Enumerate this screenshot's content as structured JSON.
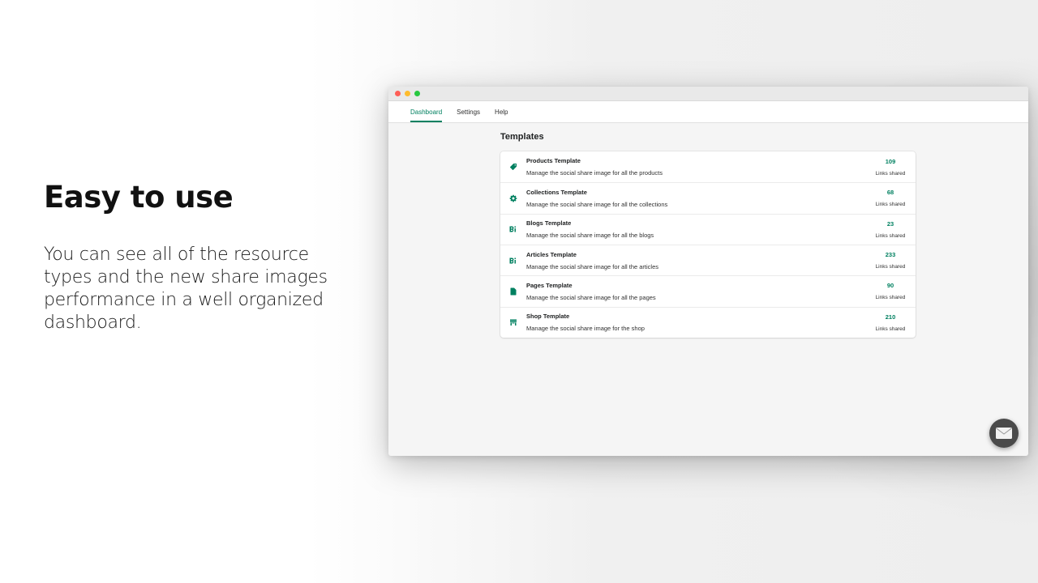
{
  "hero": {
    "title": "Easy to use",
    "description": "You can see all of the resource types and the new share images performance in a well organized dashboard."
  },
  "app": {
    "nav": {
      "tabs": [
        {
          "label": "Dashboard",
          "active": true
        },
        {
          "label": "Settings",
          "active": false
        },
        {
          "label": "Help",
          "active": false
        }
      ]
    },
    "section_title": "Templates",
    "templates": [
      {
        "title": "Products Template",
        "description": "Manage the social share image for all the products",
        "count": "109",
        "count_label": "Links shared",
        "icon": "tag-icon"
      },
      {
        "title": "Collections Template",
        "description": "Manage the social share image for all the collections",
        "count": "68",
        "count_label": "Links shared",
        "icon": "gear-icon"
      },
      {
        "title": "Blogs Template",
        "description": "Manage the social share image for all the blogs",
        "count": "23",
        "count_label": "Links shared",
        "icon": "blog-icon"
      },
      {
        "title": "Articles Template",
        "description": "Manage the social share image for all the articles",
        "count": "233",
        "count_label": "Links shared",
        "icon": "blog-icon"
      },
      {
        "title": "Pages Template",
        "description": "Manage the social share image for all the pages",
        "count": "90",
        "count_label": "Links shared",
        "icon": "page-icon"
      },
      {
        "title": "Shop Template",
        "description": "Manage the social share image for the shop",
        "count": "210",
        "count_label": "Links shared",
        "icon": "store-icon"
      }
    ],
    "colors": {
      "accent": "#008060",
      "window_dots": [
        "#fe5f57",
        "#febc2e",
        "#28c840"
      ]
    },
    "chat_button_icon": "mail-icon"
  }
}
